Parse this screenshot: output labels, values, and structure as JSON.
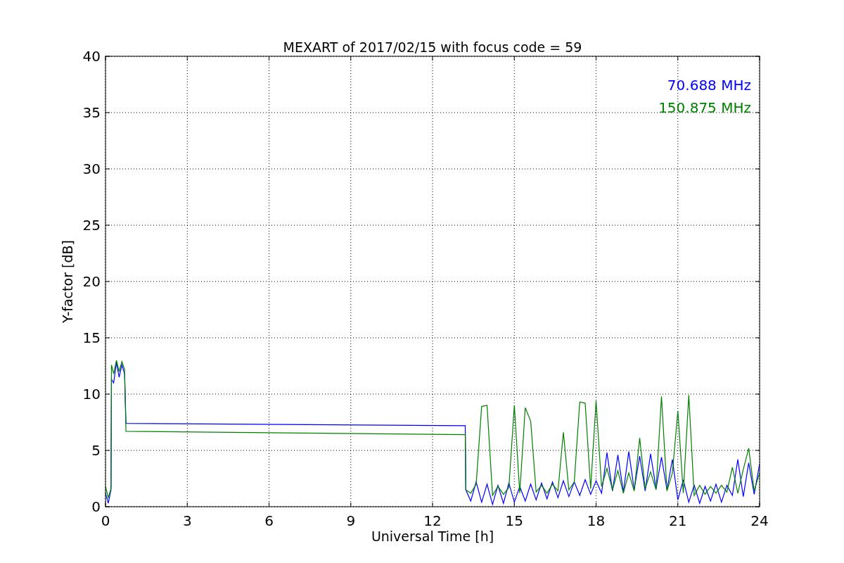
{
  "chart_data": {
    "type": "line",
    "title": "MEXART of 2017/02/15 with focus code = 59",
    "xlabel": "Universal Time [h]",
    "ylabel": "Y-factor [dB]",
    "x": [
      0,
      0.1,
      0.2,
      0.22,
      0.3,
      0.4,
      0.5,
      0.6,
      0.7,
      0.75,
      13.2,
      13.22,
      13.4,
      13.6,
      13.8,
      14.0,
      14.2,
      14.4,
      14.6,
      14.8,
      15.0,
      15.2,
      15.4,
      15.6,
      15.8,
      16.0,
      16.2,
      16.4,
      16.6,
      16.8,
      17.0,
      17.2,
      17.4,
      17.6,
      17.8,
      18.0,
      18.2,
      18.4,
      18.6,
      18.8,
      19.0,
      19.2,
      19.4,
      19.6,
      19.8,
      20.0,
      20.2,
      20.4,
      20.6,
      20.8,
      21.0,
      21.2,
      21.4,
      21.6,
      21.8,
      22.0,
      22.2,
      22.4,
      22.6,
      22.8,
      23.0,
      23.2,
      23.4,
      23.6,
      23.8,
      24.0
    ],
    "series": [
      {
        "name": "70.688 MHz",
        "color": "#0000ff",
        "values": [
          1.2,
          0.3,
          1.5,
          11.3,
          11.0,
          12.8,
          11.5,
          12.6,
          11.8,
          7.4,
          7.2,
          1.5,
          0.5,
          2.2,
          0.4,
          2.0,
          0.2,
          1.9,
          0.3,
          2.1,
          0.4,
          1.8,
          0.5,
          2.0,
          0.6,
          2.1,
          0.7,
          2.2,
          0.8,
          2.3,
          0.9,
          2.2,
          1.0,
          2.4,
          1.1,
          2.3,
          1.2,
          4.8,
          1.4,
          4.6,
          1.3,
          4.9,
          1.5,
          4.5,
          1.4,
          4.7,
          1.6,
          4.4,
          1.5,
          4.2,
          0.6,
          2.4,
          0.4,
          1.9,
          0.3,
          1.8,
          0.5,
          2.0,
          0.4,
          1.9,
          1.0,
          4.2,
          0.9,
          3.9,
          1.1,
          3.8
        ]
      },
      {
        "name": "150.875 MHz",
        "color": "#008000",
        "values": [
          1.8,
          0.8,
          1.6,
          12.6,
          11.8,
          13.0,
          12.0,
          12.9,
          12.2,
          6.7,
          6.4,
          1.5,
          1.2,
          2.0,
          8.9,
          9.0,
          1.0,
          1.8,
          1.1,
          1.7,
          9.0,
          1.2,
          8.8,
          7.6,
          1.3,
          1.9,
          1.2,
          2.0,
          1.4,
          6.6,
          1.5,
          2.2,
          9.3,
          9.2,
          1.6,
          9.4,
          1.8,
          3.4,
          1.5,
          3.2,
          1.2,
          3.0,
          1.4,
          6.1,
          1.6,
          3.1,
          1.5,
          9.8,
          1.4,
          3.0,
          8.5,
          1.2,
          9.9,
          1.0,
          1.9,
          1.1,
          1.8,
          1.2,
          1.9,
          1.3,
          3.5,
          1.2,
          3.3,
          5.2,
          1.4,
          3.0
        ]
      }
    ],
    "grid": true,
    "xlim": [
      0,
      24
    ],
    "ylim": [
      0,
      40
    ],
    "xticks": [
      0,
      3,
      6,
      9,
      12,
      15,
      18,
      21,
      24
    ],
    "yticks": [
      0,
      5,
      10,
      15,
      20,
      25,
      30,
      35,
      40
    ]
  }
}
